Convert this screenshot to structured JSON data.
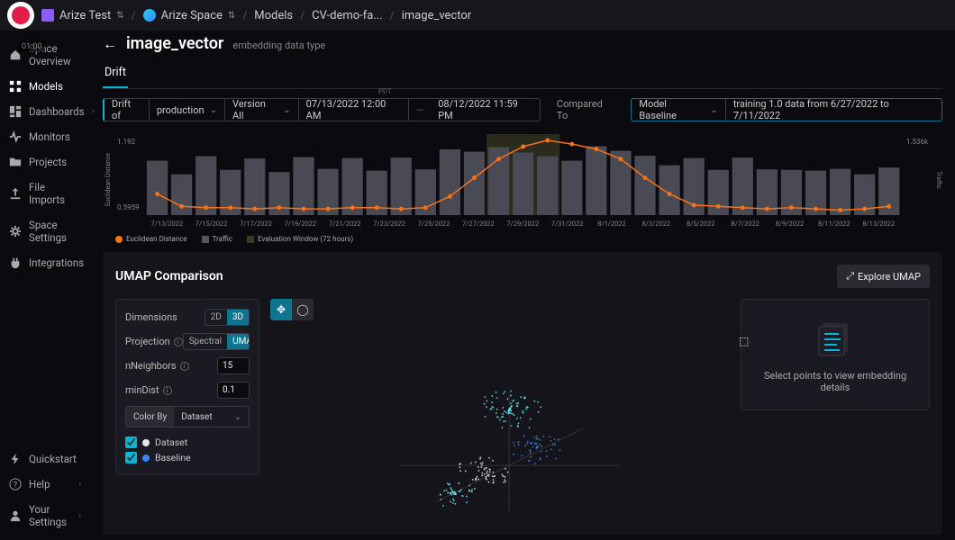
{
  "topbar": {
    "org": "Arize Test",
    "space": "Arize Space",
    "crumb1": "Models",
    "crumb2": "CV-demo-fa...",
    "crumb3": "image_vector"
  },
  "recording_time": "01:00",
  "sidebar": {
    "items": [
      {
        "label": "Space Overview"
      },
      {
        "label": "Models"
      },
      {
        "label": "Dashboards"
      },
      {
        "label": "Monitors"
      },
      {
        "label": "Projects"
      },
      {
        "label": "File Imports"
      },
      {
        "label": "Space Settings"
      },
      {
        "label": "Integrations"
      }
    ],
    "footer": [
      {
        "label": "Quickstart"
      },
      {
        "label": "Help"
      },
      {
        "label": "Your Settings"
      }
    ]
  },
  "page": {
    "title": "image_vector",
    "subtitle": "embedding data type",
    "tab": "Drift"
  },
  "controls": {
    "drift_of": "Drift of",
    "drift_env": "production",
    "version": "Version All",
    "date_from": "07/13/2022 12:00 AM",
    "date_sep": "—",
    "date_to": "08/12/2022 11:59 PM",
    "tz_label": "PDT",
    "compared_to": "Compared To",
    "baseline": "Model Baseline",
    "baseline_desc": "training 1.0 data from 6/27/2022 to 7/11/2022"
  },
  "chart_data": {
    "type": "line+bar",
    "y_left_label": "Euclidean Distance",
    "y_right_label": "Traffic",
    "y_left_ticks": [
      "1.192",
      "0.5959"
    ],
    "y_right_ticks": [
      "1.536k"
    ],
    "x_dates": [
      "7/13/2022",
      "7/15/2022",
      "7/17/2022",
      "7/19/2022",
      "7/21/2022",
      "7/23/2022",
      "7/25/2022",
      "7/27/2022",
      "7/29/2022",
      "7/31/2022",
      "8/1/2022",
      "8/3/2022",
      "8/5/2022",
      "8/7/2022",
      "8/9/2022",
      "8/11/2022",
      "8/13/2022"
    ],
    "line_values": [
      0.72,
      0.62,
      0.61,
      0.61,
      0.6,
      0.61,
      0.6,
      0.6,
      0.61,
      0.61,
      0.6,
      0.61,
      0.7,
      0.85,
      1.0,
      1.1,
      1.15,
      1.12,
      1.08,
      1.0,
      0.85,
      0.72,
      0.63,
      0.62,
      0.61,
      0.6,
      0.61,
      0.6,
      0.59,
      0.6,
      0.62
    ],
    "bar_values": [
      1200,
      900,
      1300,
      1000,
      1250,
      950,
      1280,
      1020,
      1260,
      980,
      1270,
      1010,
      1450,
      1400,
      1500,
      1380,
      1300,
      1200,
      1520,
      1420,
      1310,
      1100,
      1260,
      1000,
      1270,
      1010,
      1000,
      980,
      1020,
      900,
      1050
    ],
    "highlight_range": [
      14,
      17
    ]
  },
  "legend": {
    "euclid": "Euclidean Distance",
    "traffic": "Traffic",
    "eval": "Evaluation Window (72 hours)"
  },
  "umap": {
    "title": "UMAP Comparison",
    "explore": "Explore UMAP",
    "dimensions_label": "Dimensions",
    "dim_2d": "2D",
    "dim_3d": "3D",
    "projection_label": "Projection",
    "proj_spectral": "Spectral",
    "proj_umap": "UMAP",
    "nneighbors_label": "nNeighbors",
    "nneighbors_val": "15",
    "mindist_label": "minDist",
    "mindist_val": "0.1",
    "colorby_label": "Color By",
    "colorby_val": "Dataset",
    "check_dataset": "Dataset",
    "check_baseline": "Baseline",
    "detail_empty": "Select points to view embedding details"
  }
}
